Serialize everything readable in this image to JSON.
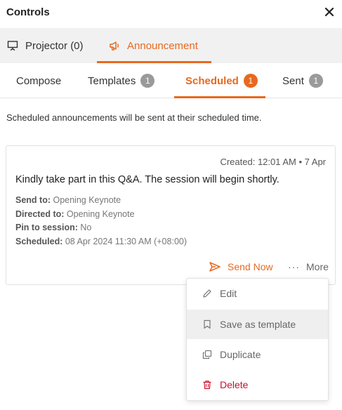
{
  "header": {
    "title": "Controls",
    "close_icon": "close-icon"
  },
  "top_tabs": [
    {
      "label": "Projector (0)",
      "icon": "projector-icon",
      "active": false
    },
    {
      "label": "Announcement",
      "icon": "megaphone-icon",
      "active": true
    }
  ],
  "sub_tabs": [
    {
      "label": "Compose",
      "badge": null,
      "active": false
    },
    {
      "label": "Templates",
      "badge": "1",
      "active": false
    },
    {
      "label": "Scheduled",
      "badge": "1",
      "active": true
    },
    {
      "label": "Sent",
      "badge": "1",
      "active": false
    }
  ],
  "info_text": "Scheduled announcements will be sent at their scheduled time.",
  "card": {
    "created": "Created: 12:01 AM • 7 Apr",
    "message": "Kindly take part in this Q&A. The session will begin shortly.",
    "details": [
      {
        "label": "Send to:",
        "value": " Opening Keynote"
      },
      {
        "label": "Directed to:",
        "value": " Opening Keynote"
      },
      {
        "label": "Pin to session:",
        "value": " No"
      },
      {
        "label": "Scheduled:",
        "value": " 08 Apr 2024 11:30 AM (+08:00)"
      }
    ],
    "send_now_label": "Send Now",
    "more_dots": "···",
    "more_label": "More"
  },
  "menu": {
    "items": [
      {
        "label": "Edit",
        "icon": "pencil-icon"
      },
      {
        "label": "Save as template",
        "icon": "bookmark-icon"
      },
      {
        "label": "Duplicate",
        "icon": "duplicate-icon"
      },
      {
        "label": "Delete",
        "icon": "trash-icon"
      }
    ]
  },
  "colors": {
    "accent": "#e8691f",
    "danger": "#c8102e",
    "badge_gray": "#9a9a9a"
  }
}
